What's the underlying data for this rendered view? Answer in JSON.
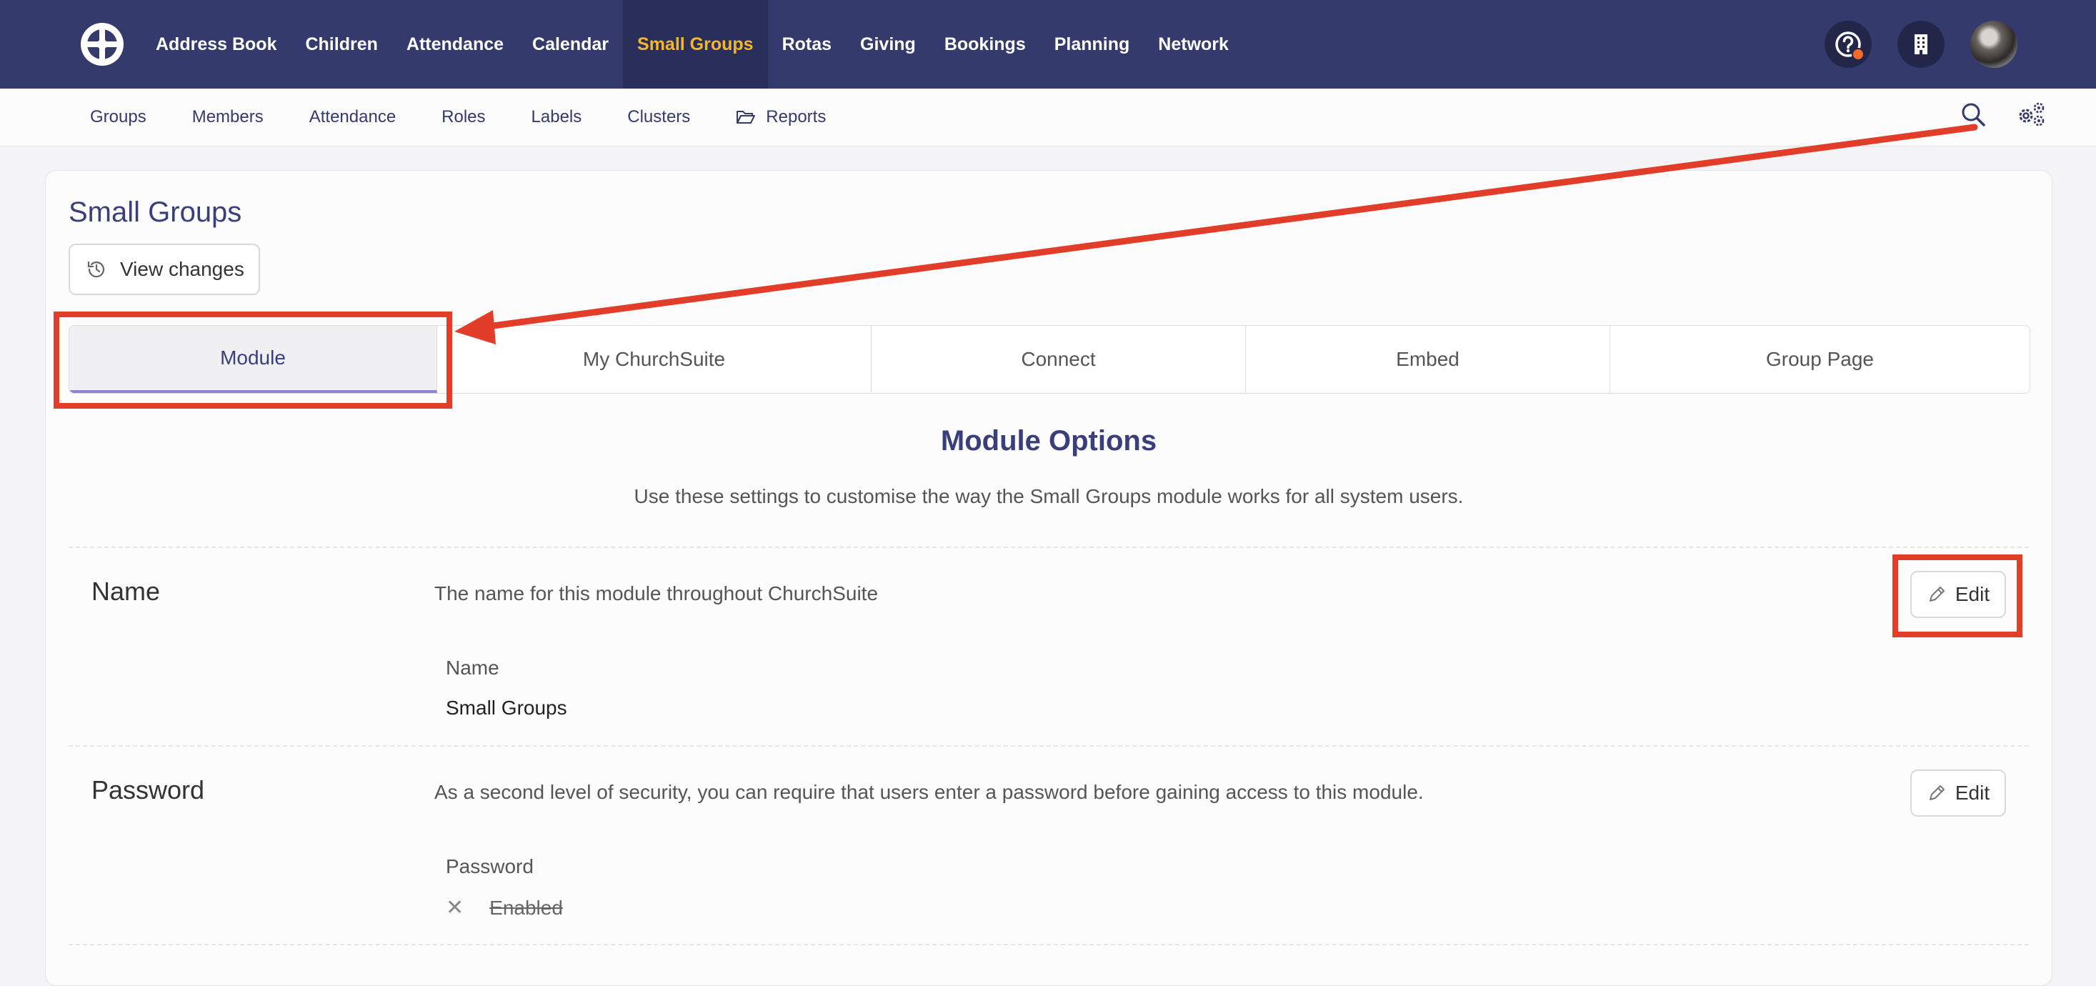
{
  "topnav": {
    "items": [
      {
        "label": "Address Book"
      },
      {
        "label": "Children"
      },
      {
        "label": "Attendance"
      },
      {
        "label": "Calendar"
      },
      {
        "label": "Small Groups",
        "active": true
      },
      {
        "label": "Rotas"
      },
      {
        "label": "Giving"
      },
      {
        "label": "Bookings"
      },
      {
        "label": "Planning"
      },
      {
        "label": "Network"
      }
    ],
    "accent_color": "#f5b62c",
    "background_color": "#343a6b",
    "icons": [
      "help-icon",
      "building-icon",
      "user-avatar"
    ]
  },
  "subnav": {
    "items": [
      {
        "label": "Groups"
      },
      {
        "label": "Members"
      },
      {
        "label": "Attendance"
      },
      {
        "label": "Roles"
      },
      {
        "label": "Labels"
      },
      {
        "label": "Clusters"
      },
      {
        "label": "Reports",
        "icon": "folder-open-icon"
      }
    ],
    "icons": [
      "search-icon",
      "settings-gear-icon"
    ]
  },
  "page": {
    "title": "Small Groups",
    "view_changes_label": "View changes",
    "tabs": [
      {
        "label": "Module",
        "active": true
      },
      {
        "label": "My ChurchSuite"
      },
      {
        "label": "Connect"
      },
      {
        "label": "Embed"
      },
      {
        "label": "Group Page"
      }
    ],
    "module_heading": "Module Options",
    "module_subtitle": "Use these settings to customise the way the Small Groups module works for all system users."
  },
  "settings": {
    "name": {
      "title": "Name",
      "description": "The name for this module throughout ChurchSuite",
      "field_label": "Name",
      "field_value": "Small Groups",
      "edit_label": "Edit"
    },
    "password": {
      "title": "Password",
      "description": "As a second level of security, you can require that users enter a password before gaining access to this module.",
      "field_label": "Password",
      "field_value": "Enabled",
      "enabled": false,
      "edit_label": "Edit"
    }
  },
  "annotation_color": "#e23d28"
}
